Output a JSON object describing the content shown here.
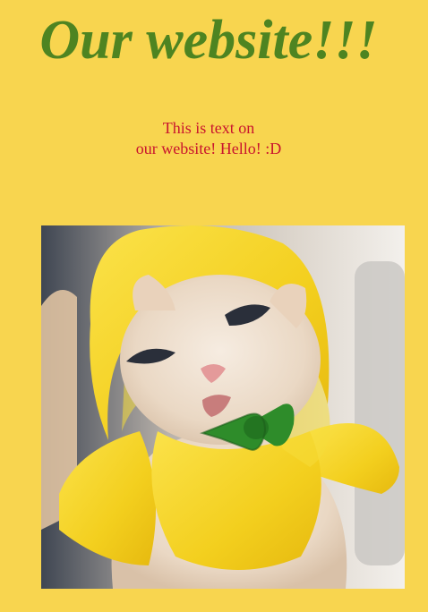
{
  "page": {
    "title": "Our website!!!",
    "intro": {
      "line1": "This is text on",
      "line2": "our website! Hello! :D"
    }
  },
  "photo": {
    "subject": "kitten-in-banana-costume-with-green-bow-tie"
  },
  "colors": {
    "background": "#f8d54f",
    "title": "#4e8421",
    "text": "#c9142e",
    "banana": "#f5d425",
    "bow": "#2e8c2a",
    "fur": "#efe0cf"
  }
}
